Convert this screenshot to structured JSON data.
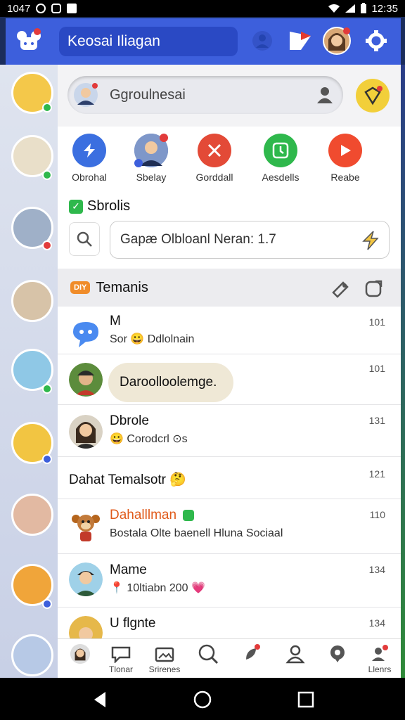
{
  "status_bar": {
    "time_left": "1047",
    "time_right": "12:35"
  },
  "appbar": {
    "title": "Keosai Iliagan"
  },
  "search": {
    "placeholder": "Ggroulnesai"
  },
  "quick_actions": [
    {
      "label": "Obrohal",
      "icon": "lightning-bolt-icon",
      "color": "#3b6fe0"
    },
    {
      "label": "Sbelay",
      "icon": "avatar-icon",
      "color": "#6b89c9"
    },
    {
      "label": "Gorddall",
      "icon": "x-mark-icon",
      "color": "#e34a37"
    },
    {
      "label": "Aesdells",
      "icon": "clock-icon",
      "color": "#2fb84c"
    },
    {
      "label": "Reabe",
      "icon": "play-icon",
      "color": "#f04b2f"
    }
  ],
  "section": {
    "title": "Sbrolis"
  },
  "secondary_search": {
    "value": "Gapæ Olbloanl Neran: 1.7"
  },
  "group": {
    "badge": "DIY",
    "title": "Temanis"
  },
  "chats": [
    {
      "name": "M",
      "preview": "Sor 😀 Ddlolnain",
      "time": "101"
    },
    {
      "name": "",
      "preview": "Daroolloolemge.",
      "time": "101"
    },
    {
      "name": "Dbrole",
      "preview": "😀 Corodcrl ⊙s",
      "time": "131"
    },
    {
      "name": "Dahat Temalsotr 🤔",
      "preview": "",
      "time": "121"
    },
    {
      "name": "Dahalllman",
      "preview": "Bostala Olte baenell Hluna Sociaal",
      "time": "110"
    },
    {
      "name": "Mame",
      "preview": "📍 10ltiabn 200 💗",
      "time": "134"
    },
    {
      "name": "U flgnte",
      "preview": "",
      "time": "134"
    }
  ],
  "bottom_nav": [
    {
      "label": "",
      "icon": "profile-avatar-icon"
    },
    {
      "label": "Tlonar",
      "icon": "chat-bubble-icon"
    },
    {
      "label": "Srirenes",
      "icon": "image-folder-icon"
    },
    {
      "label": "",
      "icon": "search-icon"
    },
    {
      "label": "",
      "icon": "rocket-icon"
    },
    {
      "label": "",
      "icon": "person-icon"
    },
    {
      "label": "",
      "icon": "speech-icon"
    },
    {
      "label": "Llenrs",
      "icon": "contacts-icon"
    }
  ],
  "colors": {
    "primary": "#3d5fdc",
    "accent_green": "#2fb84c",
    "accent_orange": "#f08c2a"
  }
}
